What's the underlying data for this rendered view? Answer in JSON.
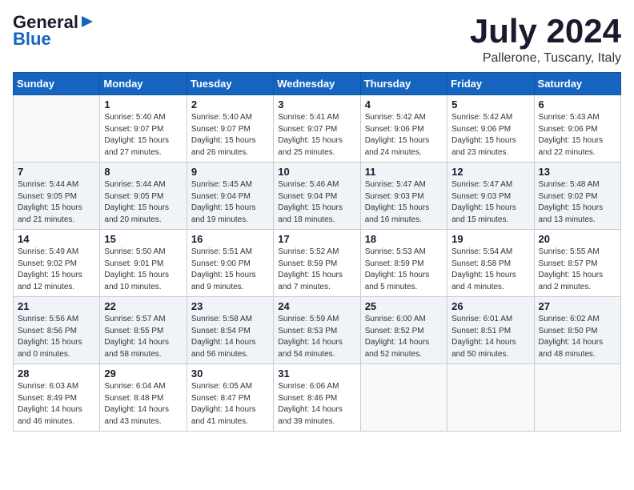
{
  "logo": {
    "line1": "General",
    "line2": "Blue",
    "arrow": "▶"
  },
  "title": "July 2024",
  "location": "Pallerone, Tuscany, Italy",
  "weekdays": [
    "Sunday",
    "Monday",
    "Tuesday",
    "Wednesday",
    "Thursday",
    "Friday",
    "Saturday"
  ],
  "weeks": [
    [
      {
        "day": "",
        "info": ""
      },
      {
        "day": "1",
        "info": "Sunrise: 5:40 AM\nSunset: 9:07 PM\nDaylight: 15 hours\nand 27 minutes."
      },
      {
        "day": "2",
        "info": "Sunrise: 5:40 AM\nSunset: 9:07 PM\nDaylight: 15 hours\nand 26 minutes."
      },
      {
        "day": "3",
        "info": "Sunrise: 5:41 AM\nSunset: 9:07 PM\nDaylight: 15 hours\nand 25 minutes."
      },
      {
        "day": "4",
        "info": "Sunrise: 5:42 AM\nSunset: 9:06 PM\nDaylight: 15 hours\nand 24 minutes."
      },
      {
        "day": "5",
        "info": "Sunrise: 5:42 AM\nSunset: 9:06 PM\nDaylight: 15 hours\nand 23 minutes."
      },
      {
        "day": "6",
        "info": "Sunrise: 5:43 AM\nSunset: 9:06 PM\nDaylight: 15 hours\nand 22 minutes."
      }
    ],
    [
      {
        "day": "7",
        "info": "Sunrise: 5:44 AM\nSunset: 9:05 PM\nDaylight: 15 hours\nand 21 minutes."
      },
      {
        "day": "8",
        "info": "Sunrise: 5:44 AM\nSunset: 9:05 PM\nDaylight: 15 hours\nand 20 minutes."
      },
      {
        "day": "9",
        "info": "Sunrise: 5:45 AM\nSunset: 9:04 PM\nDaylight: 15 hours\nand 19 minutes."
      },
      {
        "day": "10",
        "info": "Sunrise: 5:46 AM\nSunset: 9:04 PM\nDaylight: 15 hours\nand 18 minutes."
      },
      {
        "day": "11",
        "info": "Sunrise: 5:47 AM\nSunset: 9:03 PM\nDaylight: 15 hours\nand 16 minutes."
      },
      {
        "day": "12",
        "info": "Sunrise: 5:47 AM\nSunset: 9:03 PM\nDaylight: 15 hours\nand 15 minutes."
      },
      {
        "day": "13",
        "info": "Sunrise: 5:48 AM\nSunset: 9:02 PM\nDaylight: 15 hours\nand 13 minutes."
      }
    ],
    [
      {
        "day": "14",
        "info": "Sunrise: 5:49 AM\nSunset: 9:02 PM\nDaylight: 15 hours\nand 12 minutes."
      },
      {
        "day": "15",
        "info": "Sunrise: 5:50 AM\nSunset: 9:01 PM\nDaylight: 15 hours\nand 10 minutes."
      },
      {
        "day": "16",
        "info": "Sunrise: 5:51 AM\nSunset: 9:00 PM\nDaylight: 15 hours\nand 9 minutes."
      },
      {
        "day": "17",
        "info": "Sunrise: 5:52 AM\nSunset: 8:59 PM\nDaylight: 15 hours\nand 7 minutes."
      },
      {
        "day": "18",
        "info": "Sunrise: 5:53 AM\nSunset: 8:59 PM\nDaylight: 15 hours\nand 5 minutes."
      },
      {
        "day": "19",
        "info": "Sunrise: 5:54 AM\nSunset: 8:58 PM\nDaylight: 15 hours\nand 4 minutes."
      },
      {
        "day": "20",
        "info": "Sunrise: 5:55 AM\nSunset: 8:57 PM\nDaylight: 15 hours\nand 2 minutes."
      }
    ],
    [
      {
        "day": "21",
        "info": "Sunrise: 5:56 AM\nSunset: 8:56 PM\nDaylight: 15 hours\nand 0 minutes."
      },
      {
        "day": "22",
        "info": "Sunrise: 5:57 AM\nSunset: 8:55 PM\nDaylight: 14 hours\nand 58 minutes."
      },
      {
        "day": "23",
        "info": "Sunrise: 5:58 AM\nSunset: 8:54 PM\nDaylight: 14 hours\nand 56 minutes."
      },
      {
        "day": "24",
        "info": "Sunrise: 5:59 AM\nSunset: 8:53 PM\nDaylight: 14 hours\nand 54 minutes."
      },
      {
        "day": "25",
        "info": "Sunrise: 6:00 AM\nSunset: 8:52 PM\nDaylight: 14 hours\nand 52 minutes."
      },
      {
        "day": "26",
        "info": "Sunrise: 6:01 AM\nSunset: 8:51 PM\nDaylight: 14 hours\nand 50 minutes."
      },
      {
        "day": "27",
        "info": "Sunrise: 6:02 AM\nSunset: 8:50 PM\nDaylight: 14 hours\nand 48 minutes."
      }
    ],
    [
      {
        "day": "28",
        "info": "Sunrise: 6:03 AM\nSunset: 8:49 PM\nDaylight: 14 hours\nand 46 minutes."
      },
      {
        "day": "29",
        "info": "Sunrise: 6:04 AM\nSunset: 8:48 PM\nDaylight: 14 hours\nand 43 minutes."
      },
      {
        "day": "30",
        "info": "Sunrise: 6:05 AM\nSunset: 8:47 PM\nDaylight: 14 hours\nand 41 minutes."
      },
      {
        "day": "31",
        "info": "Sunrise: 6:06 AM\nSunset: 8:46 PM\nDaylight: 14 hours\nand 39 minutes."
      },
      {
        "day": "",
        "info": ""
      },
      {
        "day": "",
        "info": ""
      },
      {
        "day": "",
        "info": ""
      }
    ]
  ]
}
